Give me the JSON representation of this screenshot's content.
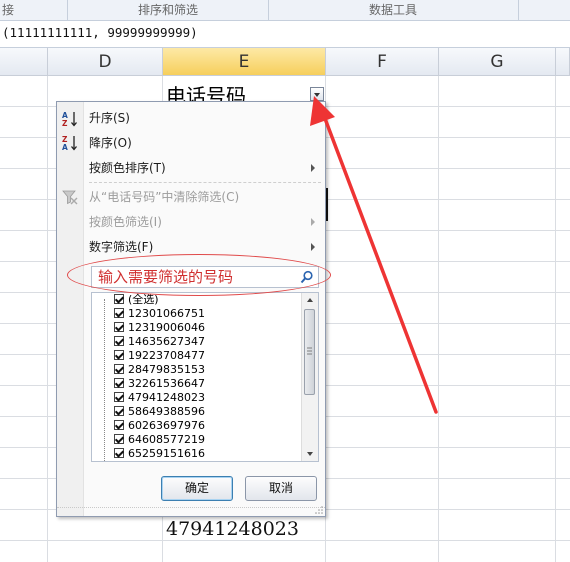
{
  "ribbon": {
    "groups": [
      "接",
      "排序和筛选",
      "数据工具"
    ]
  },
  "formula_bar": {
    "value": "(11111111111, 99999999999)"
  },
  "columns": [
    "D",
    "E",
    "F",
    "G"
  ],
  "cells": {
    "e1": "电话号码",
    "e16": "47941248023"
  },
  "filter_menu": {
    "sort_asc": "升序(S)",
    "sort_desc": "降序(O)",
    "sort_by_color": "按颜色排序(T)",
    "clear_filter": "从“电话号码”中清除筛选(C)",
    "filter_by_color": "按颜色筛选(I)",
    "number_filter": "数字筛选(F)",
    "search_placeholder": "输入需要筛选的号码",
    "items": [
      "(全选)",
      "12301066751",
      "12319006046",
      "14635627347",
      "19223708477",
      "28479835153",
      "32261536647",
      "47941248023",
      "58649388596",
      "60263697976",
      "64608577219",
      "65259151616"
    ],
    "ok_label": "确定",
    "cancel_label": "取消"
  },
  "colors": {
    "accent_red": "#e04a4a",
    "selected_header": "#f6cf5c"
  }
}
